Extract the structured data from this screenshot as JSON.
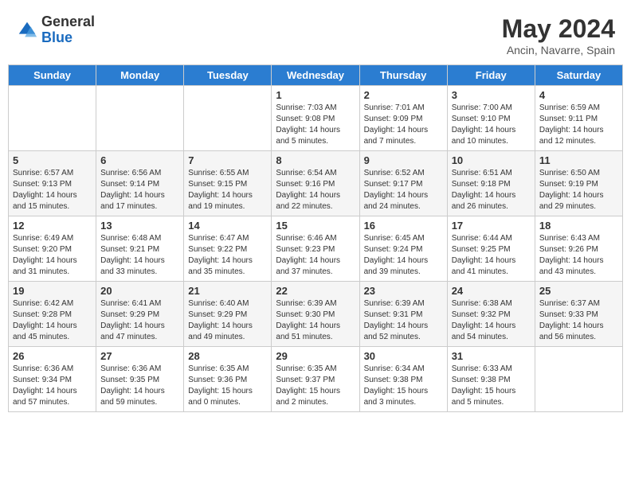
{
  "header": {
    "logo_general": "General",
    "logo_blue": "Blue",
    "month_year": "May 2024",
    "location": "Ancin, Navarre, Spain"
  },
  "weekdays": [
    "Sunday",
    "Monday",
    "Tuesday",
    "Wednesday",
    "Thursday",
    "Friday",
    "Saturday"
  ],
  "weeks": [
    [
      {
        "day": "",
        "info": ""
      },
      {
        "day": "",
        "info": ""
      },
      {
        "day": "",
        "info": ""
      },
      {
        "day": "1",
        "info": "Sunrise: 7:03 AM\nSunset: 9:08 PM\nDaylight: 14 hours\nand 5 minutes."
      },
      {
        "day": "2",
        "info": "Sunrise: 7:01 AM\nSunset: 9:09 PM\nDaylight: 14 hours\nand 7 minutes."
      },
      {
        "day": "3",
        "info": "Sunrise: 7:00 AM\nSunset: 9:10 PM\nDaylight: 14 hours\nand 10 minutes."
      },
      {
        "day": "4",
        "info": "Sunrise: 6:59 AM\nSunset: 9:11 PM\nDaylight: 14 hours\nand 12 minutes."
      }
    ],
    [
      {
        "day": "5",
        "info": "Sunrise: 6:57 AM\nSunset: 9:13 PM\nDaylight: 14 hours\nand 15 minutes."
      },
      {
        "day": "6",
        "info": "Sunrise: 6:56 AM\nSunset: 9:14 PM\nDaylight: 14 hours\nand 17 minutes."
      },
      {
        "day": "7",
        "info": "Sunrise: 6:55 AM\nSunset: 9:15 PM\nDaylight: 14 hours\nand 19 minutes."
      },
      {
        "day": "8",
        "info": "Sunrise: 6:54 AM\nSunset: 9:16 PM\nDaylight: 14 hours\nand 22 minutes."
      },
      {
        "day": "9",
        "info": "Sunrise: 6:52 AM\nSunset: 9:17 PM\nDaylight: 14 hours\nand 24 minutes."
      },
      {
        "day": "10",
        "info": "Sunrise: 6:51 AM\nSunset: 9:18 PM\nDaylight: 14 hours\nand 26 minutes."
      },
      {
        "day": "11",
        "info": "Sunrise: 6:50 AM\nSunset: 9:19 PM\nDaylight: 14 hours\nand 29 minutes."
      }
    ],
    [
      {
        "day": "12",
        "info": "Sunrise: 6:49 AM\nSunset: 9:20 PM\nDaylight: 14 hours\nand 31 minutes."
      },
      {
        "day": "13",
        "info": "Sunrise: 6:48 AM\nSunset: 9:21 PM\nDaylight: 14 hours\nand 33 minutes."
      },
      {
        "day": "14",
        "info": "Sunrise: 6:47 AM\nSunset: 9:22 PM\nDaylight: 14 hours\nand 35 minutes."
      },
      {
        "day": "15",
        "info": "Sunrise: 6:46 AM\nSunset: 9:23 PM\nDaylight: 14 hours\nand 37 minutes."
      },
      {
        "day": "16",
        "info": "Sunrise: 6:45 AM\nSunset: 9:24 PM\nDaylight: 14 hours\nand 39 minutes."
      },
      {
        "day": "17",
        "info": "Sunrise: 6:44 AM\nSunset: 9:25 PM\nDaylight: 14 hours\nand 41 minutes."
      },
      {
        "day": "18",
        "info": "Sunrise: 6:43 AM\nSunset: 9:26 PM\nDaylight: 14 hours\nand 43 minutes."
      }
    ],
    [
      {
        "day": "19",
        "info": "Sunrise: 6:42 AM\nSunset: 9:28 PM\nDaylight: 14 hours\nand 45 minutes."
      },
      {
        "day": "20",
        "info": "Sunrise: 6:41 AM\nSunset: 9:29 PM\nDaylight: 14 hours\nand 47 minutes."
      },
      {
        "day": "21",
        "info": "Sunrise: 6:40 AM\nSunset: 9:29 PM\nDaylight: 14 hours\nand 49 minutes."
      },
      {
        "day": "22",
        "info": "Sunrise: 6:39 AM\nSunset: 9:30 PM\nDaylight: 14 hours\nand 51 minutes."
      },
      {
        "day": "23",
        "info": "Sunrise: 6:39 AM\nSunset: 9:31 PM\nDaylight: 14 hours\nand 52 minutes."
      },
      {
        "day": "24",
        "info": "Sunrise: 6:38 AM\nSunset: 9:32 PM\nDaylight: 14 hours\nand 54 minutes."
      },
      {
        "day": "25",
        "info": "Sunrise: 6:37 AM\nSunset: 9:33 PM\nDaylight: 14 hours\nand 56 minutes."
      }
    ],
    [
      {
        "day": "26",
        "info": "Sunrise: 6:36 AM\nSunset: 9:34 PM\nDaylight: 14 hours\nand 57 minutes."
      },
      {
        "day": "27",
        "info": "Sunrise: 6:36 AM\nSunset: 9:35 PM\nDaylight: 14 hours\nand 59 minutes."
      },
      {
        "day": "28",
        "info": "Sunrise: 6:35 AM\nSunset: 9:36 PM\nDaylight: 15 hours\nand 0 minutes."
      },
      {
        "day": "29",
        "info": "Sunrise: 6:35 AM\nSunset: 9:37 PM\nDaylight: 15 hours\nand 2 minutes."
      },
      {
        "day": "30",
        "info": "Sunrise: 6:34 AM\nSunset: 9:38 PM\nDaylight: 15 hours\nand 3 minutes."
      },
      {
        "day": "31",
        "info": "Sunrise: 6:33 AM\nSunset: 9:38 PM\nDaylight: 15 hours\nand 5 minutes."
      },
      {
        "day": "",
        "info": ""
      }
    ]
  ]
}
